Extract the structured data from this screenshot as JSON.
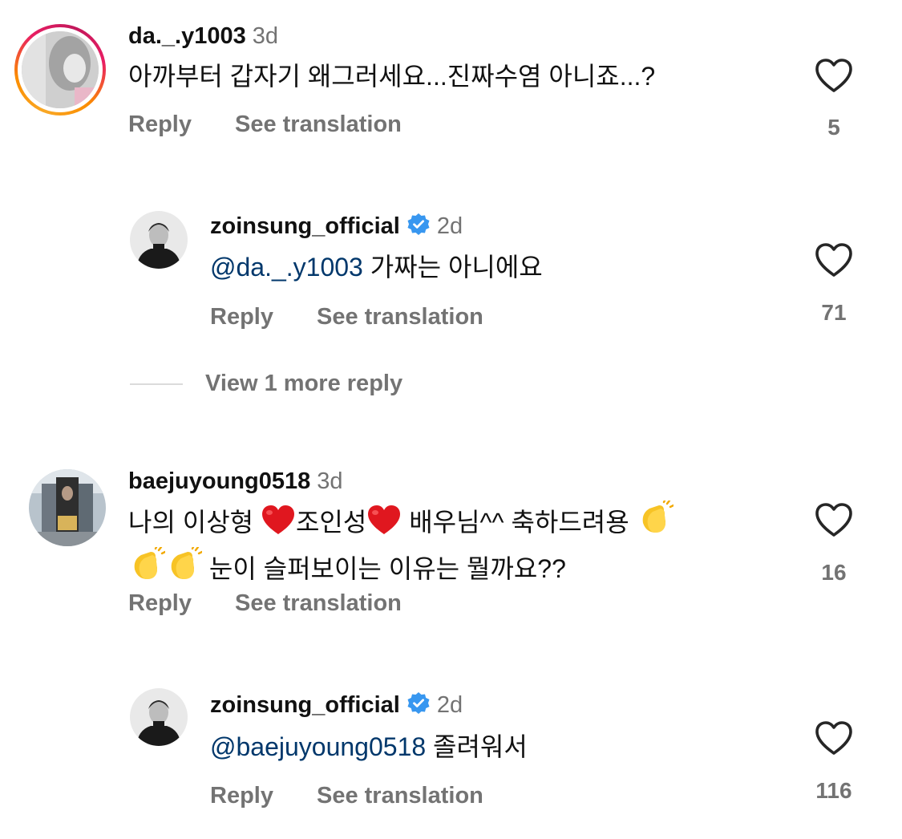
{
  "comments": [
    {
      "username": "da._.y1003",
      "time": "3d",
      "text": "아까부터 갑자기 왜그러세요...진짜수염 아니죠...?",
      "reply_label": "Reply",
      "translate_label": "See translation",
      "like_count": "5",
      "has_story_ring": true
    },
    {
      "username": "zoinsung_official",
      "verified": true,
      "time": "2d",
      "mention": "@da._.y1003",
      "text": "가짜는 아니에요",
      "reply_label": "Reply",
      "translate_label": "See translation",
      "like_count": "71"
    },
    {
      "username": "baejuyoung0518",
      "time": "3d",
      "text_parts": [
        "나의 이상형 ",
        "조인성",
        " 배우님^^ 축하드려용 ",
        "눈이 슬퍼보이는 이유는 뭘까요??"
      ],
      "emojis": [
        "red-heart",
        "red-heart",
        "clapping-hands",
        "clapping-hands",
        "clapping-hands"
      ],
      "reply_label": "Reply",
      "translate_label": "See translation",
      "like_count": "16"
    },
    {
      "username": "zoinsung_official",
      "verified": true,
      "time": "2d",
      "mention": "@baejuyoung0518",
      "text": "졸려워서",
      "reply_label": "Reply",
      "translate_label": "See translation",
      "like_count": "116"
    }
  ],
  "view_more_label": "View 1 more reply",
  "colors": {
    "secondary_text": "#737373",
    "mention": "#00376b",
    "verified_blue": "#3897f0",
    "heart_outline": "#262626"
  },
  "icons": {
    "like": "heart-outline-icon",
    "verified": "verified-badge-icon"
  }
}
